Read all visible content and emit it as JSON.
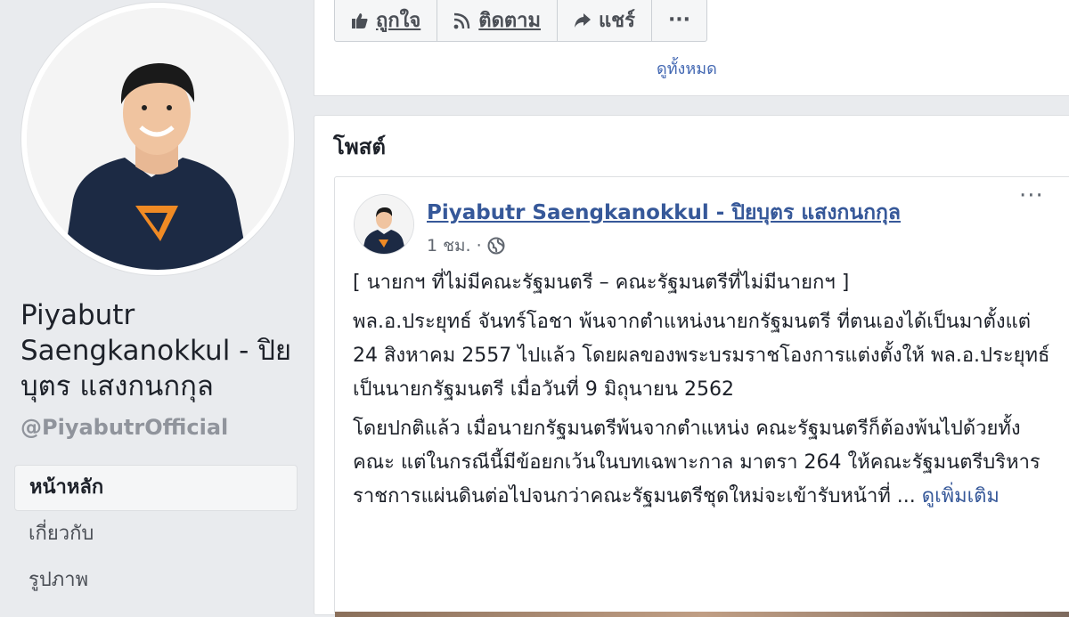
{
  "page": {
    "name": "Piyabutr Saengkanokkul - ปิยบุตร แสงกนกกุล",
    "handle": "@PiyabutrOfficial"
  },
  "nav": {
    "items": [
      {
        "label": "หน้าหลัก",
        "active": true
      },
      {
        "label": "เกี่ยวกับ",
        "active": false
      },
      {
        "label": "รูปภาพ",
        "active": false
      }
    ]
  },
  "actions": {
    "like": "ถูกใจ",
    "follow": "ติดตาม",
    "share": "แชร์",
    "more": "···"
  },
  "top_card": {
    "see_all": "ดูทั้งหมด"
  },
  "posts": {
    "title": "โพสต์",
    "items": [
      {
        "author": "Piyabutr Saengkanokkul - ปิยบุตร แสงกนกกุล",
        "time": "1 ชม.",
        "menu": "···",
        "paragraphs": [
          "[ นายกฯ ที่ไม่มีคณะรัฐมนตรี – คณะรัฐมนตรีที่ไม่มีนายกฯ ]",
          "พล.อ.ประยุทธ์ จันทร์โอชา พ้นจากตำแหน่งนายกรัฐมนตรี ที่ตนเองได้เป็นมาตั้งแต่ 24 สิงหาคม 2557 ไปแล้ว โดยผลของพระบรมราชโองการแต่งตั้งให้ พล.อ.ประยุทธ์ เป็นนายกรัฐมนตรี เมื่อวันที่ 9 มิถุนายน 2562",
          "โดยปกติแล้ว เมื่อนายกรัฐมนตรีพ้นจากตำแหน่ง คณะรัฐมนตรีก็ต้องพ้นไปด้วยทั้งคณะ แต่ในกรณีนี้มีข้อยกเว้นในบทเฉพาะกาล มาตรา 264 ให้คณะรัฐมนตรีบริหารราชการแผ่นดินต่อไปจนกว่าคณะรัฐมนตรีชุดใหม่จะเข้ารับหน้าที่ ..."
        ],
        "see_more": "ดูเพิ่มเติม"
      }
    ]
  },
  "colors": {
    "background": "#e9ebee",
    "link": "#365899",
    "shirt": "#1c2a44",
    "logo_orange": "#f08a24"
  },
  "icons": [
    "like-icon",
    "rss-icon",
    "share-icon",
    "globe-icon"
  ]
}
